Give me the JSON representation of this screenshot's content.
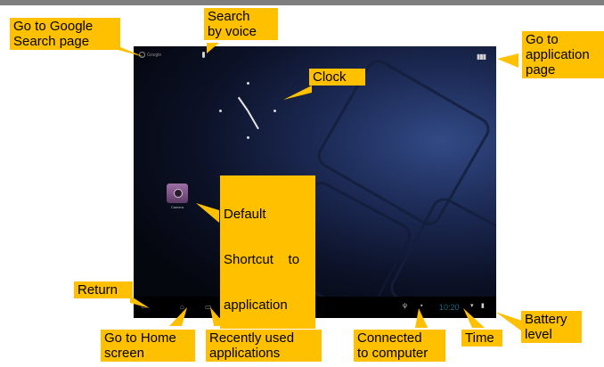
{
  "callouts": {
    "google_search": [
      "Go to Google",
      "Search page"
    ],
    "voice_search": [
      "Search",
      "by voice"
    ],
    "app_page": [
      "Go to",
      "application",
      "page"
    ],
    "clock": [
      "Clock"
    ],
    "shortcut": [
      "Default",
      "Shortcut    to",
      "application"
    ],
    "return": [
      "Return"
    ],
    "home": [
      "Go to Home",
      "screen"
    ],
    "recent": [
      "Recently used",
      "applications"
    ],
    "connected": [
      "Connected",
      "to computer"
    ],
    "time": [
      "Time"
    ],
    "battery": [
      "Battery",
      "level"
    ]
  },
  "screen": {
    "google_label": "Google",
    "app_label": "Camera"
  },
  "icons": {
    "mic": "microphone-icon",
    "apps": "apps-grid-icon",
    "back": "back-arrow-icon",
    "home": "home-icon",
    "recent": "recent-apps-icon",
    "usb": "usb-icon",
    "battery": "battery-icon",
    "wifi": "wifi-icon"
  },
  "colors": {
    "callout": "#ffc000",
    "screen_bg": "#05070f"
  }
}
